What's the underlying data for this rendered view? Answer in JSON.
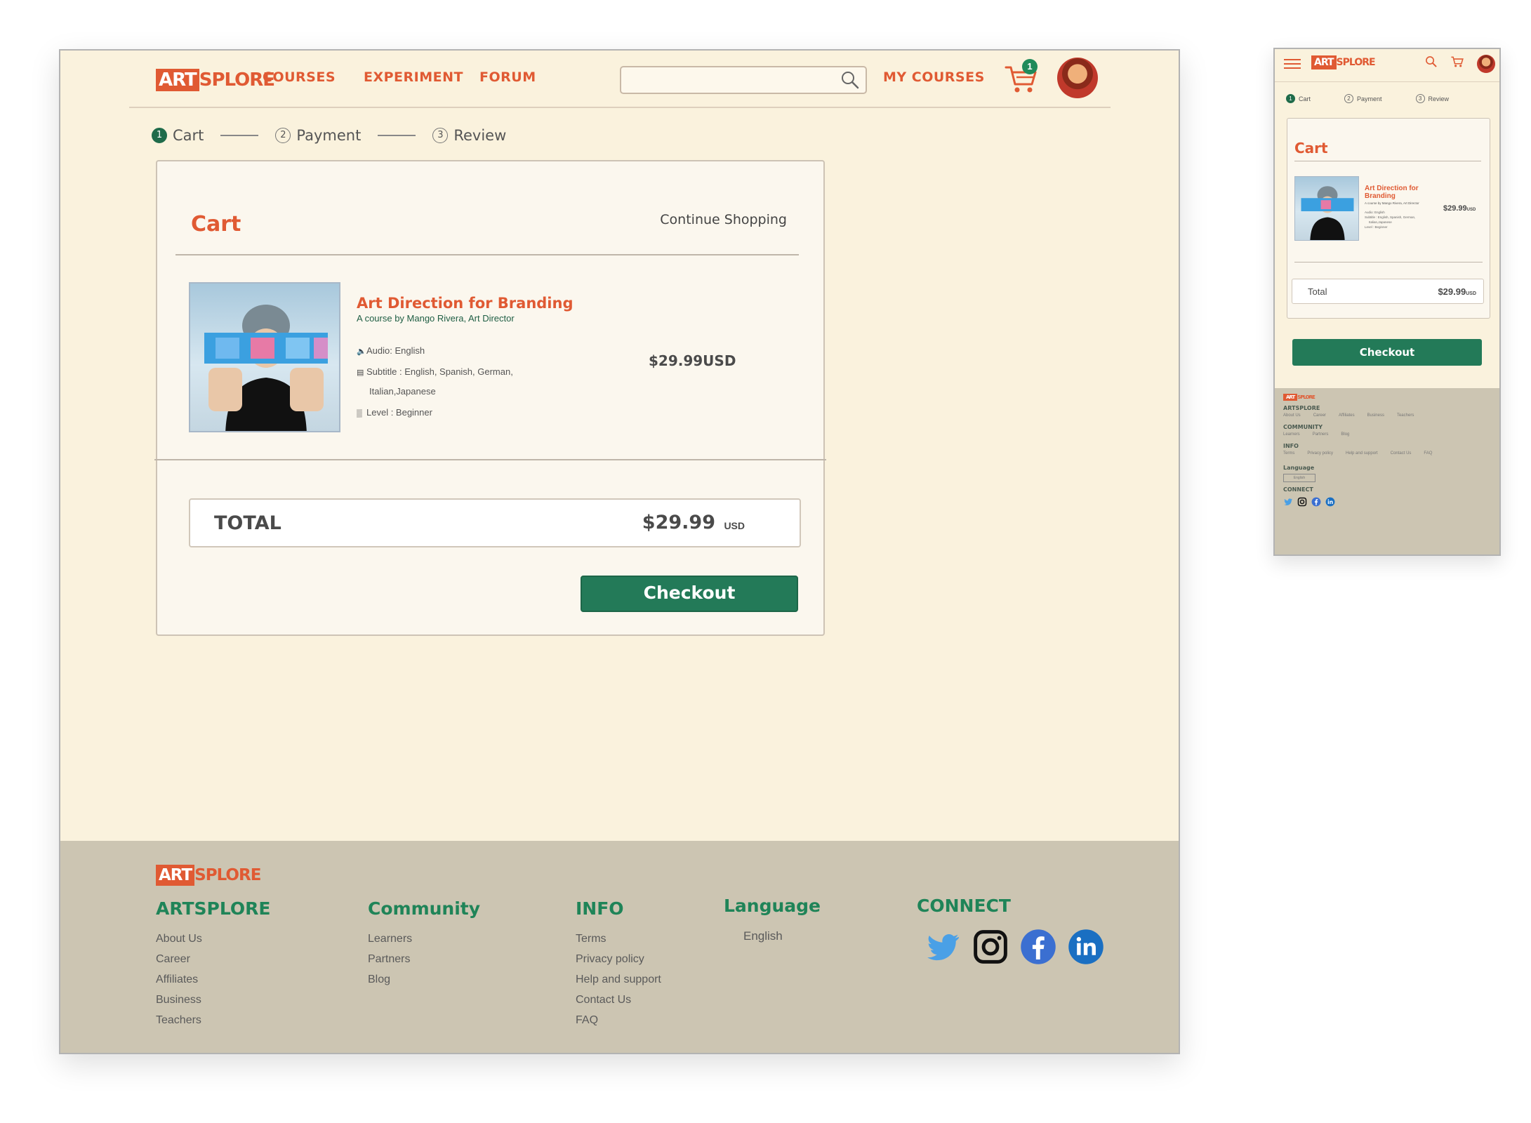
{
  "brand": {
    "box": "ART",
    "rest": "SPLORE"
  },
  "nav": {
    "courses": "COURSES",
    "experiment": "EXPERIMENT",
    "forum": "FORUM",
    "my_courses": "MY COURSES"
  },
  "search": {
    "placeholder": ""
  },
  "cart_count": "1",
  "steps": [
    {
      "num": "1",
      "label": "Cart"
    },
    {
      "num": "2",
      "label": "Payment"
    },
    {
      "num": "3",
      "label": "Review"
    }
  ],
  "cart": {
    "title": "Cart",
    "continue": "Continue Shopping",
    "item": {
      "title": "Art Direction for Branding",
      "by": "A course by Mango Rivera, Art Director",
      "audio": "Audio: English",
      "subtitle_1": "Subtitle : English, Spanish, German,",
      "subtitle_2": "Italian,Japanese",
      "level": "Level : Beginner",
      "price": "$29.99USD"
    },
    "total_label": "TOTAL",
    "total_amount": "$29.99",
    "total_currency": "USD",
    "checkout": "Checkout"
  },
  "footer": {
    "artsplore": {
      "heading": "ARTSPLORE",
      "links": [
        "About Us",
        "Career",
        "Affiliates",
        "Business",
        "Teachers"
      ]
    },
    "community": {
      "heading": "Community",
      "links": [
        "Learners",
        "Partners",
        "Blog"
      ]
    },
    "info": {
      "heading": "INFO",
      "links": [
        "Terms",
        "Privacy policy",
        "Help and support",
        "Contact Us",
        "FAQ"
      ]
    },
    "language": {
      "heading": "Language",
      "value": "English"
    },
    "connect": {
      "heading": "CONNECT"
    }
  },
  "mobile": {
    "cart_title": "Cart",
    "item_title": "Art Direction for Branding",
    "item_by": "A course by Mango Rivera, Art Director",
    "item_audio": "Audio: English",
    "item_subtitle": "Subtitle : English, Spanish, German,",
    "item_subtitle_2": "Italian,Japanese",
    "item_level": "Level : Beginner",
    "item_price": "$29.99",
    "item_price_cur": "USD",
    "total_label": "Total",
    "total_amount": "$29.99",
    "total_cur": "USD",
    "checkout": "Checkout",
    "footer": {
      "artsplore": "ARTSPLORE",
      "artsplore_links": [
        "About Us",
        "Career",
        "Affiliates",
        "Business",
        "Teachers"
      ],
      "community": "COMMUNITY",
      "community_links": [
        "Learners",
        "Partners",
        "Blog"
      ],
      "info": "INFO",
      "info_links": [
        "Terms",
        "Privacy policy",
        "Help and support",
        "Contact Us",
        "FAQ"
      ],
      "language": "Language",
      "language_value": "English",
      "connect": "CONNECT"
    }
  },
  "colors": {
    "accent": "#e05a33",
    "green": "#237a58",
    "bg": "#faf2dd",
    "footer": "#ccc5b2"
  },
  "icons": [
    "search-icon",
    "cart-icon",
    "twitter-icon",
    "instagram-icon",
    "facebook-icon",
    "linkedin-icon",
    "menu-icon",
    "audio-icon",
    "subtitle-icon",
    "level-icon"
  ]
}
